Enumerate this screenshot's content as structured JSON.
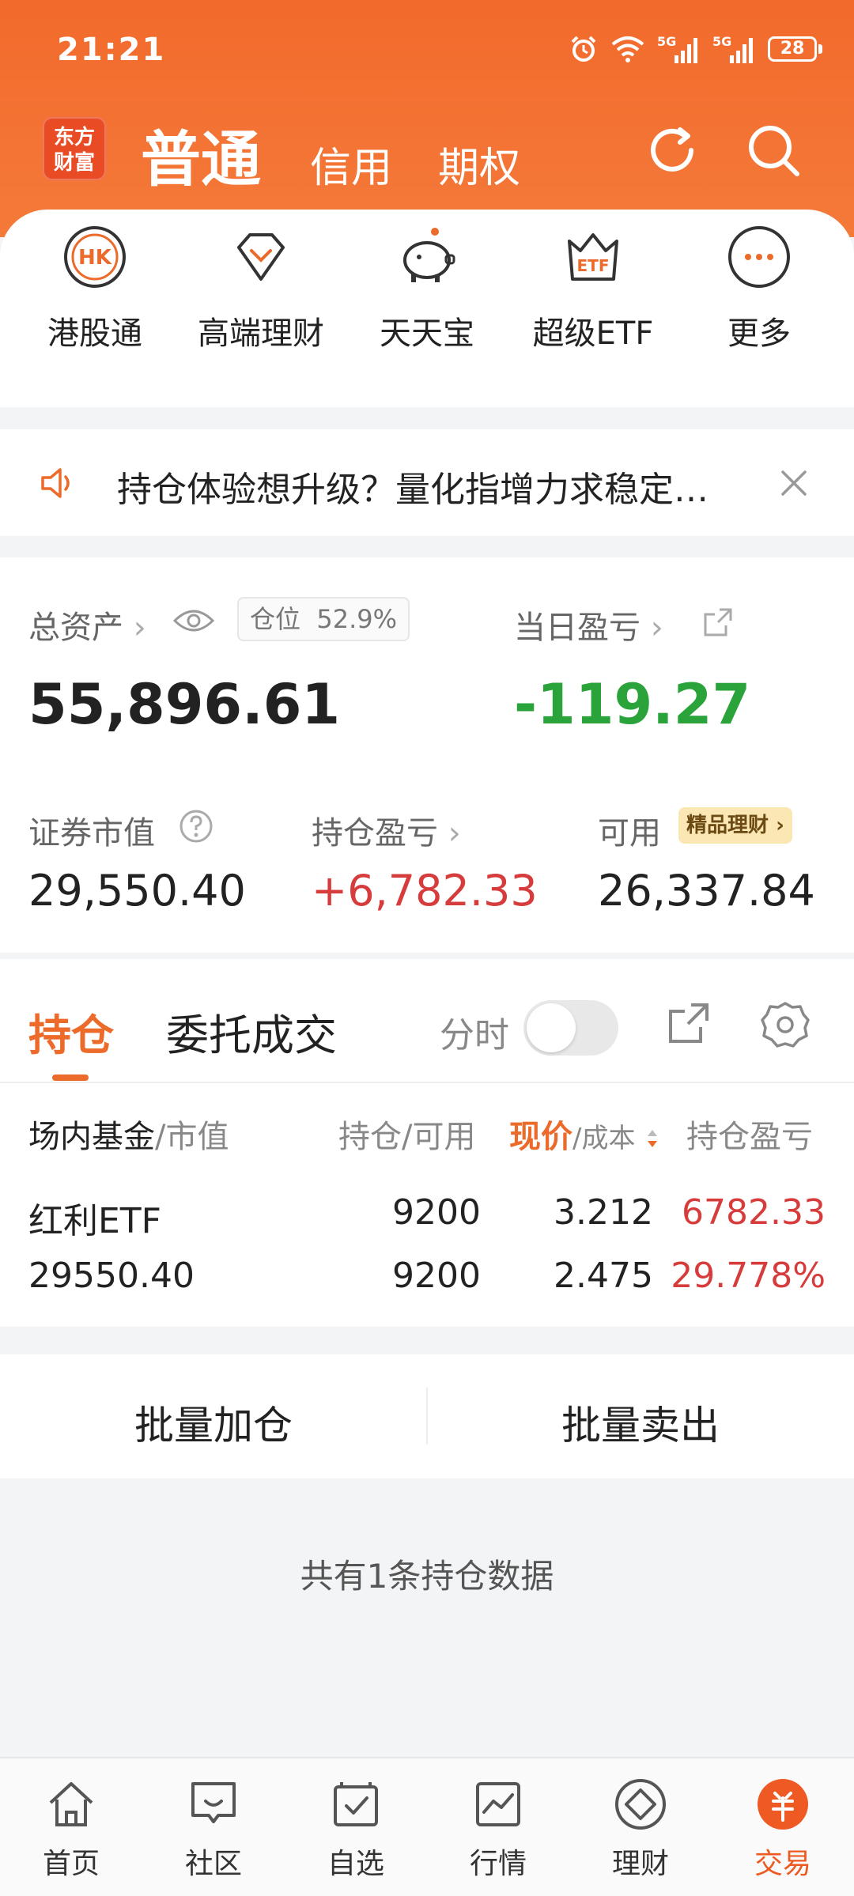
{
  "status_bar": {
    "time": "21:21",
    "battery": "28"
  },
  "header": {
    "logo_text_1": "东方",
    "logo_text_2": "财富",
    "tab_main": "普通",
    "tab_credit": "信用",
    "tab_options": "期权"
  },
  "quick_menu": [
    {
      "label": "港股通",
      "icon": "hk-icon"
    },
    {
      "label": "高端理财",
      "icon": "diamond-icon"
    },
    {
      "label": "天天宝",
      "icon": "piggy-bank-icon"
    },
    {
      "label": "超级ETF",
      "icon": "etf-crown-icon"
    },
    {
      "label": "更多",
      "icon": "more-icon"
    }
  ],
  "notice": {
    "text": "持仓体验想升级？量化指增力求稳定…"
  },
  "assets": {
    "total_label": "总资产",
    "position_label": "仓位",
    "position_value": "52.9%",
    "total_value": "55,896.61",
    "day_pnl_label": "当日盈亏",
    "day_pnl_value": "-119.27",
    "market_value_label": "证券市值",
    "market_value": "29,550.40",
    "holding_pnl_label": "持仓盈亏",
    "holding_pnl_value": "+6,782.33",
    "available_label": "可用",
    "available_badge": "精品理财",
    "available_value": "26,337.84"
  },
  "holdings": {
    "tab_holdings": "持仓",
    "tab_orders": "委托成交",
    "fenshi_label": "分时",
    "columns": {
      "name_a": "场内基金",
      "name_b": "/市值",
      "qty": "持仓/可用",
      "price_a": "现价",
      "price_b": "/成本",
      "pnl": "持仓盈亏"
    },
    "rows": [
      {
        "name": "红利ETF",
        "market_value": "29550.40",
        "position": "9200",
        "available": "9200",
        "price": "3.212",
        "cost": "2.475",
        "pnl": "6782.33",
        "pnl_pct": "29.778%"
      }
    ]
  },
  "batch": {
    "add": "批量加仓",
    "sell": "批量卖出"
  },
  "summary": {
    "count_text": "共有1条持仓数据"
  },
  "nav": [
    {
      "label": "首页",
      "icon": "home-icon"
    },
    {
      "label": "社区",
      "icon": "community-icon"
    },
    {
      "label": "自选",
      "icon": "watchlist-icon"
    },
    {
      "label": "行情",
      "icon": "market-icon"
    },
    {
      "label": "理财",
      "icon": "wealth-icon"
    },
    {
      "label": "交易",
      "icon": "trade-icon"
    }
  ],
  "colors": {
    "brand": "#ec6a2a",
    "gain": "#d73c3c",
    "loss": "#2aa33b"
  }
}
